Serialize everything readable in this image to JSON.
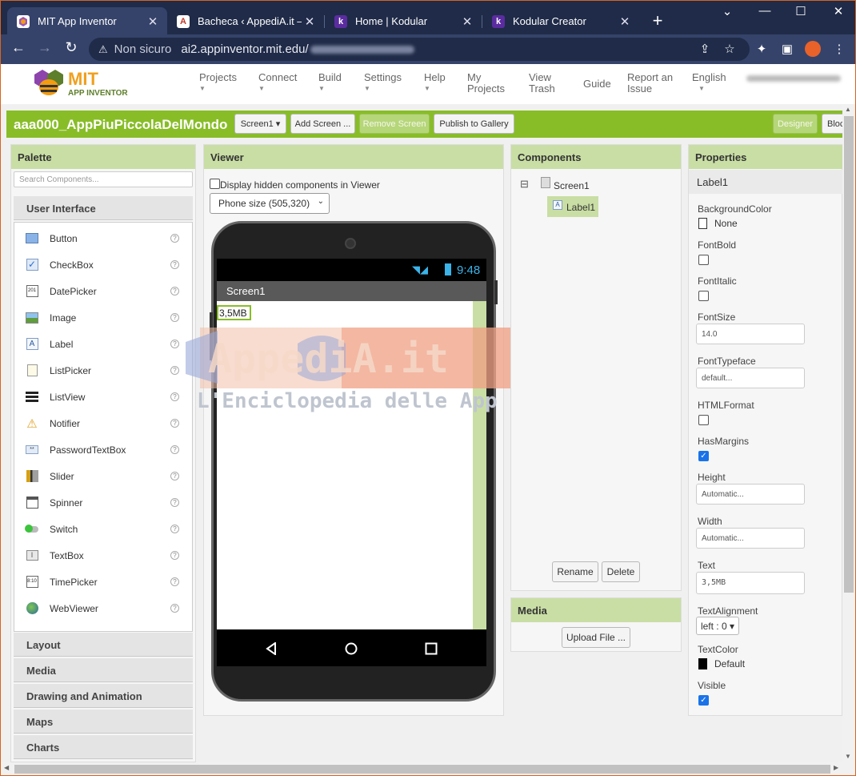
{
  "browser": {
    "tabs": [
      {
        "title": "MIT App Inventor",
        "favicon": "ai-bee-icon",
        "active": true
      },
      {
        "title": "Bacheca ‹ AppediA.it — W",
        "favicon": "appedia-icon",
        "active": false
      },
      {
        "title": "Home | Kodular",
        "favicon": "kodular-icon",
        "active": false
      },
      {
        "title": "Kodular Creator",
        "favicon": "kodular-icon",
        "active": false
      }
    ],
    "new_tab": "+",
    "window": {
      "dropdown": "⌄",
      "minimize": "—",
      "maximize": "☐",
      "close": "✕"
    },
    "security_label": "Non sicuro",
    "url": "ai2.appinventor.mit.edu/"
  },
  "topbar": {
    "logo_title": "MIT",
    "logo_subtitle": "APP INVENTOR",
    "menus": {
      "projects": "Projects",
      "connect": "Connect",
      "build": "Build",
      "settings": "Settings",
      "help": "Help",
      "my_projects_1": "My",
      "my_projects_2": "Projects",
      "view_trash_1": "View",
      "view_trash_2": "Trash",
      "guide": "Guide",
      "report_1": "Report an",
      "report_2": "Issue",
      "language": "English"
    }
  },
  "project_toolbar": {
    "project_name": "aaa000_AppPiuPiccolaDelMondo",
    "screen_select": "Screen1 ▾",
    "add_screen": "Add Screen ...",
    "remove_screen": "Remove Screen",
    "publish": "Publish to Gallery",
    "designer": "Designer",
    "blocks": "Blocks"
  },
  "palette": {
    "title": "Palette",
    "search_placeholder": "Search Components...",
    "open_category": "User Interface",
    "items": [
      {
        "label": "Button",
        "icon": "button-icon"
      },
      {
        "label": "CheckBox",
        "icon": "checkbox-icon"
      },
      {
        "label": "DatePicker",
        "icon": "datepicker-icon"
      },
      {
        "label": "Image",
        "icon": "image-icon"
      },
      {
        "label": "Label",
        "icon": "label-icon"
      },
      {
        "label": "ListPicker",
        "icon": "listpicker-icon"
      },
      {
        "label": "ListView",
        "icon": "listview-icon"
      },
      {
        "label": "Notifier",
        "icon": "notifier-icon"
      },
      {
        "label": "PasswordTextBox",
        "icon": "password-icon"
      },
      {
        "label": "Slider",
        "icon": "slider-icon"
      },
      {
        "label": "Spinner",
        "icon": "spinner-icon"
      },
      {
        "label": "Switch",
        "icon": "switch-icon"
      },
      {
        "label": "TextBox",
        "icon": "textbox-icon"
      },
      {
        "label": "TimePicker",
        "icon": "timepicker-icon"
      },
      {
        "label": "WebViewer",
        "icon": "webviewer-icon"
      }
    ],
    "help_glyph": "?",
    "categories": [
      "Layout",
      "Media",
      "Drawing and Animation",
      "Maps",
      "Charts"
    ]
  },
  "viewer": {
    "title": "Viewer",
    "hidden_checkbox_label": "Display hidden components in Viewer",
    "phone_size": "Phone size (505,320)",
    "time": "9:48",
    "screen_title": "Screen1",
    "label_text": "3,5MB",
    "watermark_title": "AppediA.it",
    "watermark_subtitle": "L'Enciclopedia delle App"
  },
  "components": {
    "title": "Components",
    "collapse": "⊟",
    "root": "Screen1",
    "child": "Label1",
    "rename": "Rename",
    "delete": "Delete"
  },
  "media": {
    "title": "Media",
    "upload": "Upload File ..."
  },
  "properties": {
    "title": "Properties",
    "component": "Label1",
    "background_color_label": "BackgroundColor",
    "background_color_value": "None",
    "font_bold_label": "FontBold",
    "font_italic_label": "FontItalic",
    "font_size_label": "FontSize",
    "font_size_value": "14.0",
    "font_typeface_label": "FontTypeface",
    "font_typeface_value": "default...",
    "html_format_label": "HTMLFormat",
    "has_margins_label": "HasMargins",
    "height_label": "Height",
    "height_value": "Automatic...",
    "width_label": "Width",
    "width_value": "Automatic...",
    "text_label": "Text",
    "text_value": "3,5MB",
    "text_alignment_label": "TextAlignment",
    "text_alignment_value": "left : 0 ▾",
    "text_color_label": "TextColor",
    "text_color_value": "Default",
    "visible_label": "Visible"
  },
  "colors": {
    "accent_green": "#88bd28",
    "panel_header": "#c9dea4",
    "browser_dark": "#1f2b48"
  }
}
